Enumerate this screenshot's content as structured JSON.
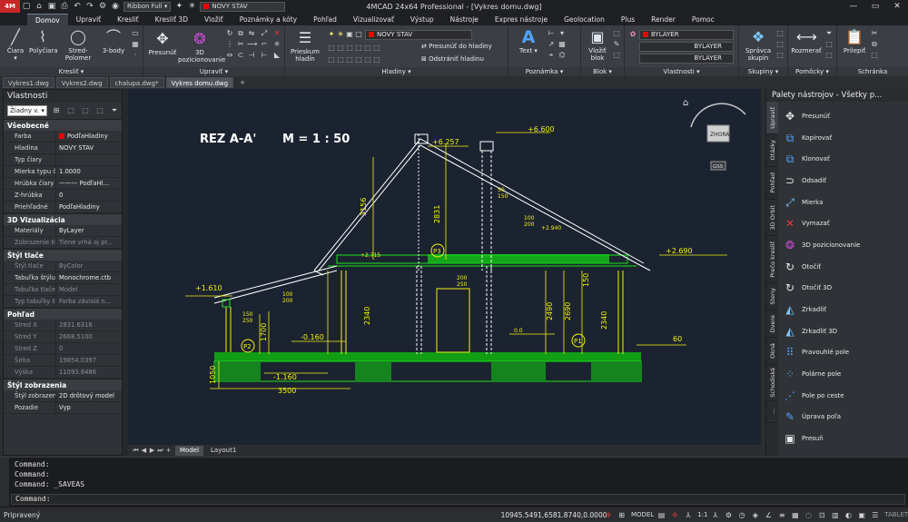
{
  "window": {
    "title": "4MCAD 24x64 Professional - [Vykres domu.dwg]",
    "logo": "4M",
    "quick_access": {
      "workspace": "Ribbon Full",
      "layer": "NOVY STAV"
    }
  },
  "ribbon": {
    "tabs": [
      "Domov",
      "Upraviť",
      "Kresliť",
      "Kresliť 3D",
      "Vložiť",
      "Poznámky a kóty",
      "Pohľad",
      "Vizualizovať",
      "Výstup",
      "Nástroje",
      "Expres nástroje",
      "Geolocation",
      "Plus",
      "Render",
      "Pomoc"
    ],
    "active_tab": "Domov",
    "groups": {
      "draw": {
        "label": "Kresliť",
        "buttons": [
          "Čiara",
          "Polyčiara",
          "Stred-Polomer",
          "3-body"
        ]
      },
      "modify": {
        "label": "Upraviť",
        "buttons": [
          "Presunúť",
          "3D pozicionovanie"
        ]
      },
      "layers": {
        "label": "Hladiny",
        "explore": "Prieskum hladín",
        "layer_combo": "NOVY STAV",
        "move_to_layer": "Presunúť do hladiny",
        "remove_layer": "Odstrániť hladinu"
      },
      "annotation": {
        "label": "Poznámka",
        "text": "Text"
      },
      "block": {
        "label": "Blok",
        "insert": "Vložiť blok"
      },
      "properties": {
        "label": "Vlastnosti",
        "color": "BYLAYER",
        "linetype": "BYLAYER",
        "lineweight": "BYLAYER"
      },
      "groups": {
        "label": "Skupiny",
        "manage": "Správca skupín"
      },
      "tools": {
        "label": "Pomôcky",
        "measure": "Rozmerať"
      },
      "clipboard": {
        "label": "Schránka",
        "paste": "Prilepiť"
      }
    }
  },
  "documents": {
    "tabs": [
      "Vykres1.dwg",
      "Vykres2.dwg",
      "chalupa.dwg*",
      "Vykres domu.dwg"
    ],
    "active": "Vykres domu.dwg",
    "add": "+"
  },
  "properties_panel": {
    "title": "Vlastnosti",
    "selection": "Žiadny v.",
    "sections": [
      {
        "title": "Všeobecné",
        "rows": [
          {
            "k": "Farba",
            "v": "PodľaHladiny",
            "swatch": true
          },
          {
            "k": "Hladina",
            "v": "NOVY STAV"
          },
          {
            "k": "Typ čiary",
            "v": ""
          },
          {
            "k": "Mierka typu čiary",
            "v": "1.0000"
          },
          {
            "k": "Hrúbka čiary",
            "v": "——— PodľaHl..."
          },
          {
            "k": "Z-hrúbka",
            "v": "0"
          },
          {
            "k": "Priehľadné",
            "v": "PodľaHladiny"
          }
        ]
      },
      {
        "title": "3D Vizualizácia",
        "rows": [
          {
            "k": "Materiály",
            "v": "ByLayer"
          },
          {
            "k": "Zobrazenie tieň...",
            "v": "Tiene vrhá aj pr...",
            "dim": true
          }
        ]
      },
      {
        "title": "Štýl tlače",
        "rows": [
          {
            "k": "Štýl tlače",
            "v": "ByColor",
            "dim": true
          },
          {
            "k": "Tabuľka štýlu tl...",
            "v": "Monochrome.ctb"
          },
          {
            "k": "Tabuľka tlače ...",
            "v": "Model",
            "dim": true
          },
          {
            "k": "Typ tabuľky tlače",
            "v": "Farba závislá n...",
            "dim": true
          }
        ]
      },
      {
        "title": "Pohľad",
        "rows": [
          {
            "k": "Stred X",
            "v": "2831.6316",
            "dim": true
          },
          {
            "k": "Stred Y",
            "v": "2668.5100",
            "dim": true
          },
          {
            "k": "Stred Z",
            "v": "0",
            "dim": true
          },
          {
            "k": "Šírka",
            "v": "19854.0397",
            "dim": true
          },
          {
            "k": "Výška",
            "v": "11093.8486",
            "dim": true
          }
        ]
      },
      {
        "title": "Štýl zobrazenia",
        "rows": [
          {
            "k": "Štýl zobrazenia",
            "v": "2D drôtový model"
          },
          {
            "k": "Pozadie",
            "v": "Vyp"
          }
        ]
      }
    ]
  },
  "drawing": {
    "title": "REZ A-A'",
    "scale": "M = 1 : 50",
    "viewcube": {
      "face": "ZHORA",
      "wcs": "GSS"
    },
    "dims": {
      "ridge": "+6.257",
      "chimney": "+6.600",
      "right_eave": "+2.690",
      "left_eave": "+1.610",
      "floor": "-0.160",
      "ground": "-1.160",
      "mid": "+2.715",
      "left_h": "3156",
      "chim_h": "2831",
      "rh1": "2490",
      "rh2": "2690",
      "rh3": "150",
      "lh1": "2340",
      "lh2": "1700",
      "rh4": "2340",
      "lbase": "1050",
      "wbase": "3500",
      "n1": "100",
      "n2": "200",
      "n3": "150",
      "n4": "250",
      "n5": "200",
      "n6": "250",
      "n7": "100",
      "n8": "200",
      "n9": "50",
      "n10": "150",
      "val60": "60",
      "val00": "0.0",
      "p2": "P2",
      "p3": "P3",
      "p1": "P1",
      "top2": "+2.940"
    }
  },
  "layout_tabs": {
    "tabs": [
      "Model",
      "Layout1"
    ],
    "active": "Model"
  },
  "palette": {
    "title": "Palety nástrojov - Všetky p...",
    "vtabs": [
      "Upraviť",
      "Otázky",
      "Pohľad",
      "3D Orbit",
      "Prečo kresliť",
      "Steny",
      "Dvere",
      "Okná",
      "Schodiská",
      "..."
    ],
    "items": [
      "Presunúť",
      "Kopírovať",
      "Klonovať",
      "Odsadiť",
      "Mierka",
      "Vymazať",
      "3D pozicionovanie",
      "Otočiť",
      "Otočiť 3D",
      "Zrkadliť",
      "Zrkadliť 3D",
      "Pravouhlé pole",
      "Polárne pole",
      "Pole po ceste",
      "Úprava poľa",
      "Presuň"
    ]
  },
  "command": {
    "history": [
      "Command:",
      "Command:",
      "Command:  _SAVEAS"
    ],
    "prompt": "Command:"
  },
  "status": {
    "left": "Pripravený",
    "coords": "10945.5491,6581.8740,0.0000",
    "model": "MODEL",
    "scale": "1:1",
    "tablet": "TABLET"
  },
  "colors": {
    "accent": "#6d7c95",
    "drawing_bg": "#1c2330",
    "lines_green": "#19e619",
    "lines_yellow": "#f2f20f",
    "hatch": "#13d313"
  }
}
